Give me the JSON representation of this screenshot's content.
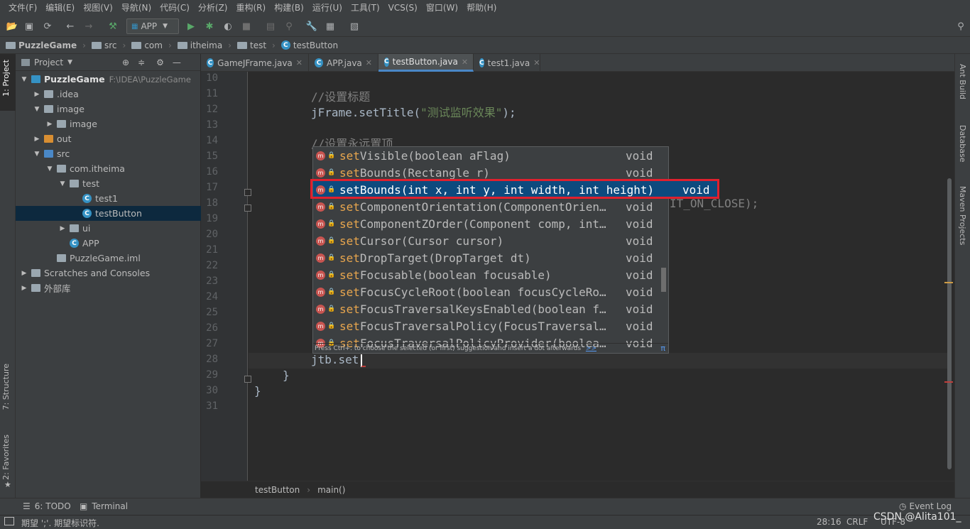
{
  "menu": [
    "文件(F)",
    "编辑(E)",
    "视图(V)",
    "导航(N)",
    "代码(C)",
    "分析(Z)",
    "重构(R)",
    "构建(B)",
    "运行(U)",
    "工具(T)",
    "VCS(S)",
    "窗口(W)",
    "帮助(H)"
  ],
  "toolbar": {
    "run_config": "APP",
    "dropdown_icon": "chevron-down-icon"
  },
  "breadcrumb": [
    {
      "label": "PuzzleGame",
      "icon": "module-icon"
    },
    {
      "label": "src",
      "icon": "folder-icon"
    },
    {
      "label": "com",
      "icon": "folder-icon"
    },
    {
      "label": "itheima",
      "icon": "folder-icon"
    },
    {
      "label": "test",
      "icon": "folder-icon"
    },
    {
      "label": "testButton",
      "icon": "class-icon"
    }
  ],
  "left_strip": {
    "project": "1: Project",
    "structure": "7: Structure",
    "favorites": "2: Favorites"
  },
  "right_strip": {
    "ant": "Ant Build",
    "database": "Database",
    "maven": "Maven Projects"
  },
  "project_panel": {
    "title": "Project",
    "tree": [
      {
        "label": "PuzzleGame",
        "path": "F:\\IDEA\\PuzzleGame",
        "indent": 0,
        "arrow": "▼",
        "icon": "module"
      },
      {
        "label": ".idea",
        "indent": 1,
        "arrow": "▶",
        "icon": "folder"
      },
      {
        "label": "image",
        "indent": 1,
        "arrow": "▼",
        "icon": "folder"
      },
      {
        "label": "image",
        "indent": 2,
        "arrow": "▶",
        "icon": "folder"
      },
      {
        "label": "out",
        "indent": 1,
        "arrow": "▶",
        "icon": "folder-orange"
      },
      {
        "label": "src",
        "indent": 1,
        "arrow": "▼",
        "icon": "folder-blue"
      },
      {
        "label": "com.itheima",
        "indent": 2,
        "arrow": "▼",
        "icon": "package"
      },
      {
        "label": "test",
        "indent": 3,
        "arrow": "▼",
        "icon": "package"
      },
      {
        "label": "test1",
        "indent": 4,
        "arrow": "",
        "icon": "class"
      },
      {
        "label": "testButton",
        "indent": 4,
        "arrow": "",
        "icon": "class",
        "selected": true
      },
      {
        "label": "ui",
        "indent": 3,
        "arrow": "▶",
        "icon": "package"
      },
      {
        "label": "APP",
        "indent": 3,
        "arrow": "",
        "icon": "class"
      },
      {
        "label": "PuzzleGame.iml",
        "indent": 2,
        "arrow": "",
        "icon": "file"
      },
      {
        "label": "Scratches and Consoles",
        "indent": 0,
        "arrow": "▶",
        "icon": "scratch"
      },
      {
        "label": "外部库",
        "indent": 0,
        "arrow": "▶",
        "icon": "library"
      }
    ]
  },
  "tabs": [
    {
      "label": "GameJFrame.java",
      "active": false
    },
    {
      "label": "APP.java",
      "active": false
    },
    {
      "label": "testButton.java",
      "active": true
    },
    {
      "label": "test1.java",
      "active": false
    }
  ],
  "editor": {
    "lines": [
      {
        "n": "10",
        "text": "",
        "cls": ""
      },
      {
        "n": "11",
        "text": "//设置标题",
        "cls": "cmt"
      },
      {
        "n": "12",
        "text": "jFrame.setTitle(\"测试监听效果\");",
        "cls": "mix"
      },
      {
        "n": "13",
        "text": "",
        "cls": ""
      },
      {
        "n": "14",
        "text": "//设置永远置顶",
        "cls": "cmt"
      },
      {
        "n": "15",
        "text": "",
        "cls": ""
      },
      {
        "n": "16",
        "text": "",
        "cls": ""
      },
      {
        "n": "17",
        "text": "",
        "cls": ""
      },
      {
        "n": "18",
        "text": "",
        "cls": ""
      },
      {
        "n": "19",
        "text": "",
        "cls": ""
      },
      {
        "n": "20",
        "text": "",
        "cls": ""
      },
      {
        "n": "21",
        "text": "",
        "cls": ""
      },
      {
        "n": "22",
        "text": "",
        "cls": ""
      },
      {
        "n": "23",
        "text": "",
        "cls": ""
      },
      {
        "n": "24",
        "text": "",
        "cls": ""
      },
      {
        "n": "25",
        "text": "",
        "cls": ""
      },
      {
        "n": "26",
        "text": "",
        "cls": ""
      },
      {
        "n": "27",
        "text": "",
        "cls": ""
      },
      {
        "n": "28",
        "text": "jtb.set",
        "cls": ""
      },
      {
        "n": "29",
        "text": "}",
        "cls": "indent1"
      },
      {
        "n": "30",
        "text": "}",
        "cls": "indent0"
      },
      {
        "n": "31",
        "text": "",
        "cls": ""
      }
    ],
    "code_before_str": "jFrame.setTitle(",
    "string_literal": "\"测试监听效果\"",
    "code_after_str": ");",
    "partial_visible": "IT_ON_CLOSE);"
  },
  "completion": {
    "items": [
      {
        "match": "set",
        "rest": "Visible(boolean aFlag)",
        "type": "void"
      },
      {
        "match": "set",
        "rest": "Bounds(Rectangle r)",
        "type": "void"
      },
      {
        "match": "set",
        "rest": "Bounds(int x, int y, int width, int height)",
        "type": "void",
        "selected": true
      },
      {
        "match": "set",
        "rest": "ComponentOrientation(ComponentOrien…",
        "type": "void"
      },
      {
        "match": "set",
        "rest": "ComponentZOrder(Component comp, int…",
        "type": "void"
      },
      {
        "match": "set",
        "rest": "Cursor(Cursor cursor)",
        "type": "void"
      },
      {
        "match": "set",
        "rest": "DropTarget(DropTarget dt)",
        "type": "void"
      },
      {
        "match": "set",
        "rest": "Focusable(boolean focusable)",
        "type": "void"
      },
      {
        "match": "set",
        "rest": "FocusCycleRoot(boolean focusCycleRo…",
        "type": "void"
      },
      {
        "match": "set",
        "rest": "FocusTraversalKeysEnabled(boolean f…",
        "type": "void"
      },
      {
        "match": "set",
        "rest": "FocusTraversalPolicy(FocusTraversal…",
        "type": "void"
      },
      {
        "match": "set",
        "rest": "FocusTraversalPolicyProvider(boolea…",
        "type": "void"
      }
    ],
    "footer": "Press Ctrl+. to choose the selected (or first) suggestion and insert a dot afterwards",
    "footer_link": ">>",
    "pi": "π"
  },
  "editor_breadcrumb": [
    "testButton",
    "main()"
  ],
  "bottom_tabs": [
    {
      "label": "6: TODO"
    },
    {
      "label": "Terminal"
    }
  ],
  "event_log": "Event Log",
  "status": {
    "message": "期望 ';'. 期望标识符.",
    "position": "28:16",
    "line_sep": "CRLF",
    "encoding": "UTF-8",
    "watermark": "CSDN @Alita101_"
  }
}
